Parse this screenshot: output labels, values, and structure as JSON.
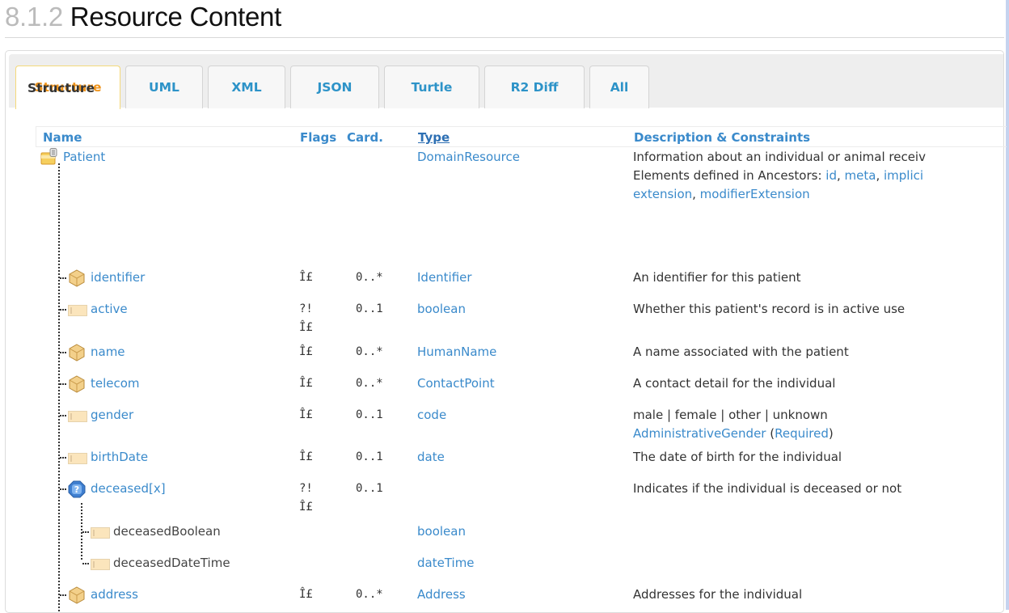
{
  "heading": {
    "number": "8.1.2",
    "title": "Resource Content"
  },
  "tabs": [
    {
      "label": "Structure",
      "active": true
    },
    {
      "label": "UML",
      "active": false
    },
    {
      "label": "XML",
      "active": false
    },
    {
      "label": "JSON",
      "active": false
    },
    {
      "label": "Turtle",
      "active": false
    },
    {
      "label": "R2 Diff",
      "active": false
    },
    {
      "label": "All",
      "active": false
    }
  ],
  "panel_title": "Structure",
  "columns": {
    "name": "Name",
    "flags": "Flags",
    "card": "Card.",
    "type": "Type",
    "desc": "Description & Constraints"
  },
  "root": {
    "name": "Patient",
    "icon": "resource-folder-icon",
    "type": "DomainResource",
    "desc_line1": "Information about an individual or animal receiv",
    "desc_line2_prefix": "Elements defined in Ancestors: ",
    "ancestors": [
      "id",
      "meta",
      "implici",
      "extension",
      "modifierExtension"
    ]
  },
  "rows": [
    {
      "name": "identifier",
      "icon": "datatype-cube-icon",
      "flags": "Î£",
      "card": "0..*",
      "type": "Identifier",
      "desc": "An identifier for this patient"
    },
    {
      "name": "active",
      "icon": "primitive-icon",
      "flags": "?!",
      "flags2": "Î£",
      "card": "0..1",
      "type": "boolean",
      "desc": "Whether this patient's record is in active use"
    },
    {
      "name": "name",
      "icon": "datatype-cube-icon",
      "flags": "Î£",
      "card": "0..*",
      "type": "HumanName",
      "desc": "A name associated with the patient"
    },
    {
      "name": "telecom",
      "icon": "datatype-cube-icon",
      "flags": "Î£",
      "card": "0..*",
      "type": "ContactPoint",
      "desc": "A contact detail for the individual"
    },
    {
      "name": "gender",
      "icon": "primitive-icon",
      "flags": "Î£",
      "card": "0..1",
      "type": "code",
      "desc": "male | female | other | unknown",
      "binding": "AdministrativeGender",
      "binding_strength": "Required"
    },
    {
      "name": "birthDate",
      "icon": "primitive-icon",
      "flags": "Î£",
      "card": "0..1",
      "type": "date",
      "desc": "The date of birth for the individual"
    },
    {
      "name": "deceased[x]",
      "icon": "choice-icon",
      "flags": "?!",
      "flags2": "Î£",
      "card": "0..1",
      "type": "",
      "desc": "Indicates if the individual is deceased or not"
    },
    {
      "name": "deceasedBoolean",
      "icon": "primitive-icon",
      "flags": "",
      "card": "",
      "type": "boolean",
      "desc": ""
    },
    {
      "name": "deceasedDateTime",
      "icon": "primitive-icon",
      "flags": "",
      "card": "",
      "type": "dateTime",
      "desc": ""
    },
    {
      "name": "address",
      "icon": "datatype-cube-icon",
      "flags": "Î£",
      "card": "0..*",
      "type": "Address",
      "desc": "Addresses for the individual"
    }
  ]
}
